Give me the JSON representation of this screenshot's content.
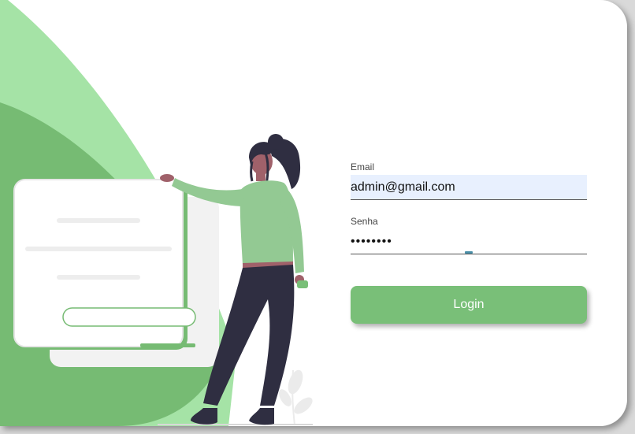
{
  "login_form": {
    "email_label": "Email",
    "email_value": "admin@gmail.com",
    "password_label": "Senha",
    "password_value": "12345678",
    "login_label": "Login"
  },
  "colors": {
    "accent": "#79bf78",
    "accent_light": "#a5e3a6",
    "autofill_bg": "#e8f0fe"
  },
  "illustration": {
    "subject": "woman-pointing-at-login-card"
  }
}
